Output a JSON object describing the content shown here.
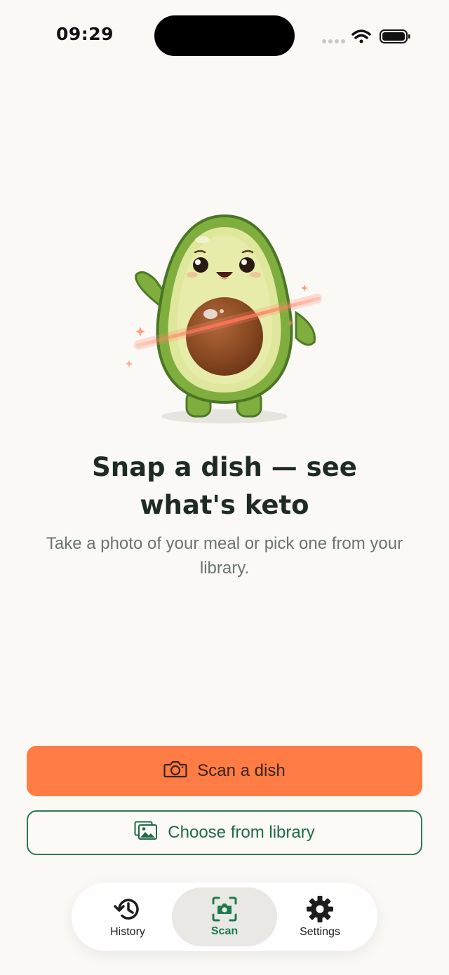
{
  "status_bar": {
    "time": "09:29"
  },
  "hero": {
    "icon": "avocado-mascot"
  },
  "headline": "Snap a dish — see what's keto",
  "subtext": "Take a photo of your meal or pick one from your library.",
  "actions": {
    "primary": {
      "label": "Scan a dish",
      "icon": "camera-icon",
      "color": "#ff7c45"
    },
    "secondary": {
      "label": "Choose from library",
      "icon": "photo-library-icon",
      "color": "#2f7a54"
    }
  },
  "tab_bar": {
    "items": [
      {
        "label": "History",
        "icon": "history-icon",
        "selected": false
      },
      {
        "label": "Scan",
        "icon": "scan-camera-icon",
        "selected": true
      },
      {
        "label": "Settings",
        "icon": "gear-icon",
        "selected": false
      }
    ]
  }
}
